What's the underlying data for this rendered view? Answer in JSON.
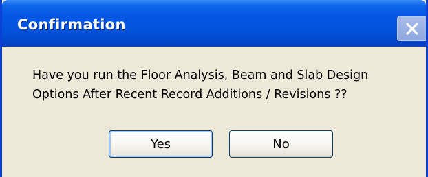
{
  "dialog": {
    "title": "Confirmation",
    "message_line1": "Have you run the Floor Analysis, Beam and Slab Design",
    "message_line2": "Options After Recent Record Additions / Revisions ??",
    "buttons": {
      "yes_label": "Yes",
      "no_label": "No",
      "close_icon": "close-icon"
    }
  },
  "colors": {
    "titlebar": "#0556e3",
    "dialog_body": "#ece9d8",
    "title_text": "#ffffff",
    "button_border": "#003c74"
  }
}
